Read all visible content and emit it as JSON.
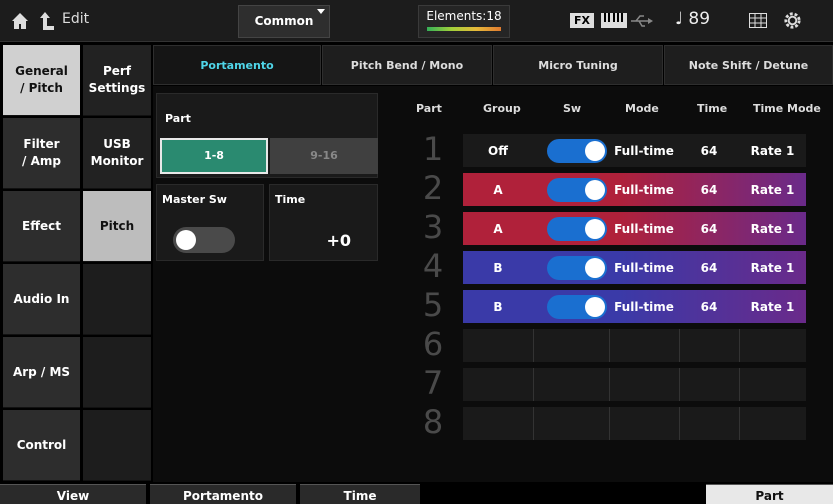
{
  "topbar": {
    "edit_label": "Edit",
    "common_label": "Common",
    "elements_label": "Elements:18",
    "fx_label": "FX",
    "tempo": "♩ 89",
    "icons": [
      "home-icon",
      "up-arrow-icon",
      "keyboard-icon",
      "usb-icon",
      "grid-icon",
      "gear-icon"
    ]
  },
  "nav1": [
    {
      "label": "General\n/ Pitch",
      "active": true
    },
    {
      "label": "Filter\n/ Amp",
      "active": false
    },
    {
      "label": "Effect",
      "active": false
    },
    {
      "label": "Audio In",
      "active": false
    },
    {
      "label": "Arp / MS",
      "active": false
    },
    {
      "label": "Control",
      "active": false
    }
  ],
  "nav2": [
    {
      "label": "Perf\nSettings",
      "active": false
    },
    {
      "label": "USB\nMonitor",
      "active": false
    },
    {
      "label": "Pitch",
      "active": true
    },
    {
      "label": "",
      "active": false
    },
    {
      "label": "",
      "active": false
    },
    {
      "label": "",
      "active": false
    }
  ],
  "tabs": [
    {
      "label": "Portamento",
      "active": true
    },
    {
      "label": "Pitch Bend / Mono",
      "active": false
    },
    {
      "label": "Micro Tuning",
      "active": false
    },
    {
      "label": "Note Shift / Detune",
      "active": false
    }
  ],
  "part_panel": {
    "title": "Part",
    "seg_a": "1-8",
    "seg_b": "9-16"
  },
  "master_panel": {
    "title": "Master Sw",
    "on": false
  },
  "time_panel": {
    "title": "Time",
    "value": "+0"
  },
  "table": {
    "headers": {
      "part": "Part",
      "group": "Group",
      "sw": "Sw",
      "mode": "Mode",
      "time": "Time",
      "time_mode": "Time Mode"
    },
    "part_numbers": [
      "1",
      "2",
      "3",
      "4",
      "5",
      "6",
      "7",
      "8"
    ],
    "rows": [
      {
        "group": "Off",
        "sw": true,
        "mode": "Full-time",
        "time": "64",
        "time_mode": "Rate 1",
        "color": "#1a1a1a"
      },
      {
        "group": "A",
        "sw": true,
        "mode": "Full-time",
        "time": "64",
        "time_mode": "Rate 1",
        "color": "#b0213a"
      },
      {
        "group": "A",
        "sw": true,
        "mode": "Full-time",
        "time": "64",
        "time_mode": "Rate 1",
        "color": "#b0213a"
      },
      {
        "group": "B",
        "sw": true,
        "mode": "Full-time",
        "time": "64",
        "time_mode": "Rate 1",
        "color": "#3a3aa8"
      },
      {
        "group": "B",
        "sw": true,
        "mode": "Full-time",
        "time": "64",
        "time_mode": "Rate 1",
        "color": "#3a3aa8"
      },
      {
        "group": "",
        "sw": false,
        "mode": "",
        "time": "",
        "time_mode": "",
        "color": ""
      },
      {
        "group": "",
        "sw": false,
        "mode": "",
        "time": "",
        "time_mode": "",
        "color": ""
      },
      {
        "group": "",
        "sw": false,
        "mode": "",
        "time": "",
        "time_mode": "",
        "color": ""
      }
    ]
  },
  "bottombar": {
    "view": "View",
    "portamento": "Portamento",
    "time": "Time",
    "part": "Part"
  }
}
